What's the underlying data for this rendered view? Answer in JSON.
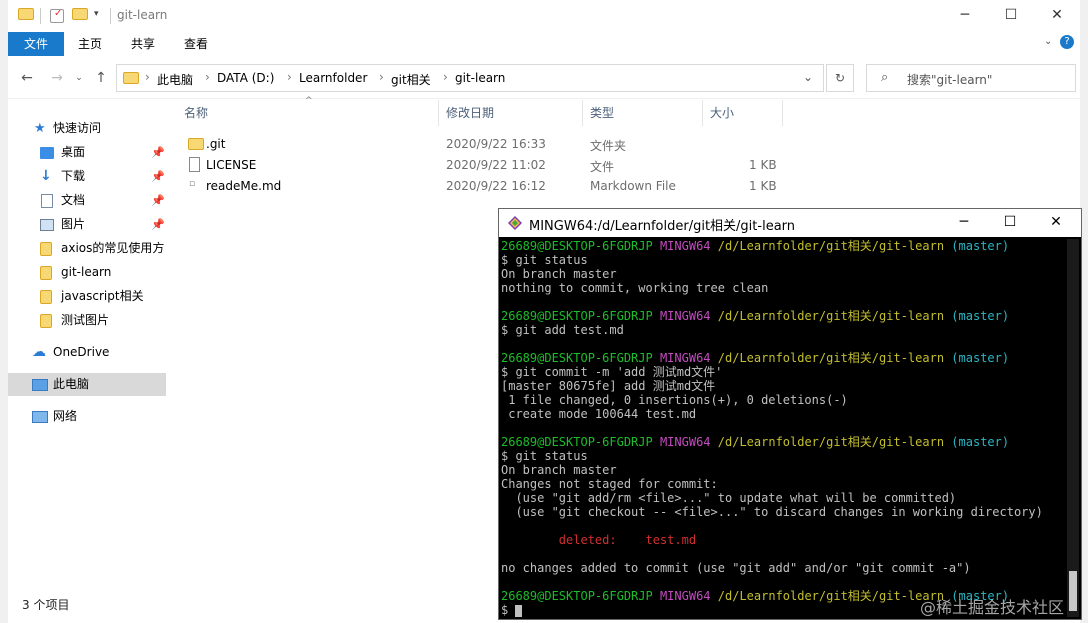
{
  "window": {
    "title": "git-learn",
    "ribbon_tabs": [
      "文件",
      "主页",
      "共享",
      "查看"
    ]
  },
  "address": {
    "crumbs": [
      "此电脑",
      "DATA (D:)",
      "Learnfolder",
      "git相关",
      "git-learn"
    ],
    "search_placeholder": "搜索\"git-learn\""
  },
  "nav": {
    "quick_access": "快速访问",
    "items": [
      {
        "label": "桌面",
        "pinned": true
      },
      {
        "label": "下载",
        "pinned": true
      },
      {
        "label": "文档",
        "pinned": true
      },
      {
        "label": "图片",
        "pinned": true
      },
      {
        "label": "axios的常见使用方",
        "pinned": false
      },
      {
        "label": "git-learn",
        "pinned": false
      },
      {
        "label": "javascript相关",
        "pinned": false
      },
      {
        "label": "测试图片",
        "pinned": false
      }
    ],
    "onedrive": "OneDrive",
    "this_pc": "此电脑",
    "network": "网络"
  },
  "files": {
    "columns": [
      "名称",
      "修改日期",
      "类型",
      "大小"
    ],
    "rows": [
      {
        "name": ".git",
        "date": "2020/9/22 16:33",
        "type": "文件夹",
        "size": ""
      },
      {
        "name": "LICENSE",
        "date": "2020/9/22 11:02",
        "type": "文件",
        "size": "1 KB"
      },
      {
        "name": "readeMe.md",
        "date": "2020/9/22 16:12",
        "type": "Markdown File",
        "size": "1 KB"
      }
    ]
  },
  "status": {
    "count": "3 个项目"
  },
  "terminal": {
    "title": "MINGW64:/d/Learnfolder/git相关/git-learn",
    "prompt": {
      "user": "26689@DESKTOP-6FGDRJP",
      "sys": "MINGW64",
      "path": "/d/Learnfolder/git相关/git-learn",
      "branch": "(master)"
    },
    "l_cmd1": "$ git status",
    "l_out1a": "On branch master",
    "l_out1b": "nothing to commit, working tree clean",
    "l_cmd2": "$ git add test.md",
    "l_cmd3": "$ git commit -m 'add 测试md文件'",
    "l_out3a": "[master 80675fe] add 测试md文件",
    "l_out3b": " 1 file changed, 0 insertions(+), 0 deletions(-)",
    "l_out3c": " create mode 100644 test.md",
    "l_cmd4": "$ git status",
    "l_out4a": "On branch master",
    "l_out4b": "Changes not staged for commit:",
    "l_out4c": "  (use \"git add/rm <file>...\" to update what will be committed)",
    "l_out4d": "  (use \"git checkout -- <file>...\" to discard changes in working directory)",
    "l_deleted_label": "        deleted:",
    "l_deleted_file": "test.md",
    "l_out4e": "no changes added to commit (use \"git add\" and/or \"git commit -a\")",
    "l_last": "$ "
  },
  "watermark": "@稀土掘金技术社区"
}
